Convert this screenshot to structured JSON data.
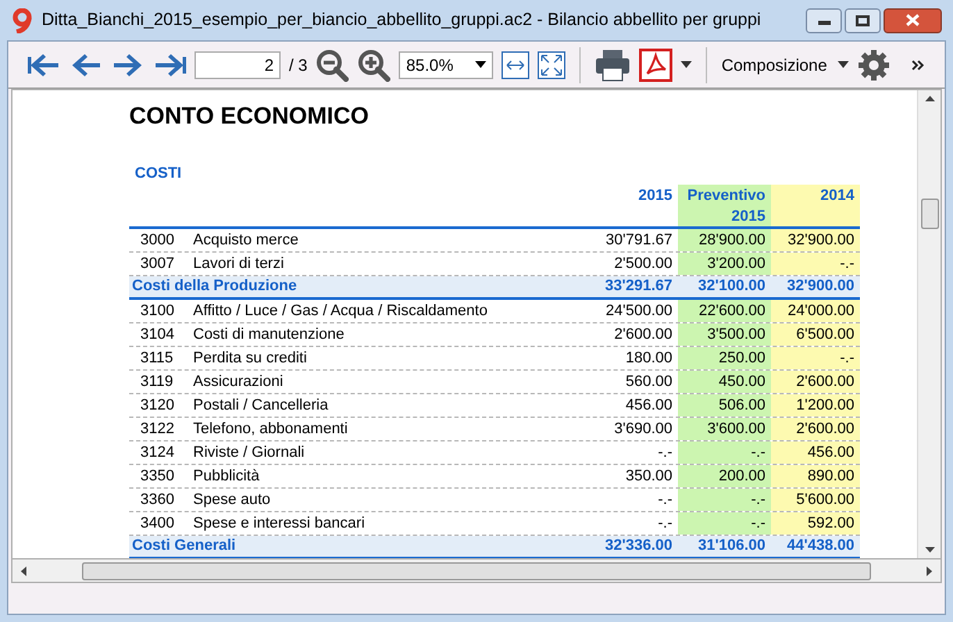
{
  "window": {
    "title": "Ditta_Bianchi_2015_esempio_per_biancio_abbellito_gruppi.ac2 - Bilancio abbellito per gruppi"
  },
  "toolbar": {
    "page": "2",
    "page_total": "/ 3",
    "zoom": "85.0%",
    "composition": "Composizione"
  },
  "report": {
    "title": "CONTO ECONOMICO",
    "section": "COSTI",
    "columns": [
      "2015",
      "Preventivo 2015",
      "2014"
    ],
    "rows": [
      {
        "kind": "account",
        "code": "3000",
        "description": "Acquisto merce",
        "values": [
          "30'791.67",
          "28'900.00",
          "32'900.00"
        ]
      },
      {
        "kind": "account",
        "code": "3007",
        "description": "Lavori di terzi",
        "values": [
          "2'500.00",
          "3'200.00",
          "-.-"
        ]
      },
      {
        "kind": "total",
        "description": "Costi della Produzione",
        "values": [
          "33'291.67",
          "32'100.00",
          "32'900.00"
        ]
      },
      {
        "kind": "account",
        "code": "3100",
        "description": "Affitto / Luce / Gas / Acqua / Riscaldamento",
        "values": [
          "24'500.00",
          "22'600.00",
          "24'000.00"
        ]
      },
      {
        "kind": "account",
        "code": "3104",
        "description": "Costi di manutenzione",
        "values": [
          "2'600.00",
          "3'500.00",
          "6'500.00"
        ]
      },
      {
        "kind": "account",
        "code": "3115",
        "description": "Perdita su crediti",
        "values": [
          "180.00",
          "250.00",
          "-.-"
        ]
      },
      {
        "kind": "account",
        "code": "3119",
        "description": "Assicurazioni",
        "values": [
          "560.00",
          "450.00",
          "2'600.00"
        ]
      },
      {
        "kind": "account",
        "code": "3120",
        "description": "Postali / Cancelleria",
        "values": [
          "456.00",
          "506.00",
          "1'200.00"
        ]
      },
      {
        "kind": "account",
        "code": "3122",
        "description": "Telefono, abbonamenti",
        "values": [
          "3'690.00",
          "3'600.00",
          "2'600.00"
        ]
      },
      {
        "kind": "account",
        "code": "3124",
        "description": "Riviste / Giornali",
        "values": [
          "-.-",
          "-.-",
          "456.00"
        ]
      },
      {
        "kind": "account",
        "code": "3350",
        "description": "Pubblicità",
        "values": [
          "350.00",
          "200.00",
          "890.00"
        ]
      },
      {
        "kind": "account",
        "code": "3360",
        "description": "Spese auto",
        "values": [
          "-.-",
          "-.-",
          "5'600.00"
        ]
      },
      {
        "kind": "account",
        "code": "3400",
        "description": "Spese e interessi bancari",
        "values": [
          "-.-",
          "-.-",
          "592.00"
        ]
      },
      {
        "kind": "total",
        "description": "Costi Generali",
        "values": [
          "32'336.00",
          "31'106.00",
          "44'438.00"
        ]
      }
    ]
  }
}
